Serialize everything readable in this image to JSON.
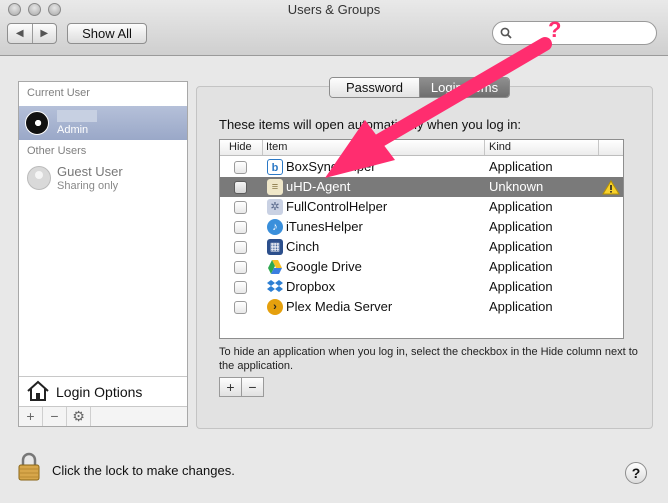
{
  "window": {
    "title": "Users & Groups",
    "show_all_label": "Show All"
  },
  "sidebar": {
    "current_user_header": "Current User",
    "current_user_role": "Admin",
    "other_users_header": "Other Users",
    "guest_name": "Guest User",
    "guest_status": "Sharing only",
    "login_options_label": "Login Options"
  },
  "tabs": {
    "password": "Password",
    "login_items": "Login Items"
  },
  "login_items": {
    "intro": "These items will open automatically when you log in:",
    "headers": {
      "hide": "Hide",
      "item": "Item",
      "kind": "Kind"
    },
    "rows": [
      {
        "name": "BoxSyncHelper",
        "kind": "Application",
        "icon": "box-icon",
        "color": "#2b78c5"
      },
      {
        "name": "uHD-Agent",
        "kind": "Unknown",
        "icon": "document-icon",
        "color": "#bbb",
        "selected": true,
        "warning": true
      },
      {
        "name": "FullControlHelper",
        "kind": "Application",
        "icon": "gear-cluster-icon",
        "color": "#7c8aa8"
      },
      {
        "name": "iTunesHelper",
        "kind": "Application",
        "icon": "music-note-icon",
        "color": "#3a8fdb"
      },
      {
        "name": "Cinch",
        "kind": "Application",
        "icon": "window-grid-icon",
        "color": "#2c4f8c"
      },
      {
        "name": "Google Drive",
        "kind": "Application",
        "icon": "drive-triangle-icon",
        "color": "#2fa84f"
      },
      {
        "name": "Dropbox",
        "kind": "Application",
        "icon": "dropbox-icon",
        "color": "#2d7fd3"
      },
      {
        "name": "Plex Media Server",
        "kind": "Application",
        "icon": "plex-icon",
        "color": "#e5a00d"
      }
    ],
    "hint": "To hide an application when you log in, select the checkbox in the Hide column next to the application."
  },
  "footer": {
    "lock_text": "Click the lock to make changes."
  },
  "annotation": {
    "question_mark": "?",
    "color": "#ff2d6f"
  }
}
